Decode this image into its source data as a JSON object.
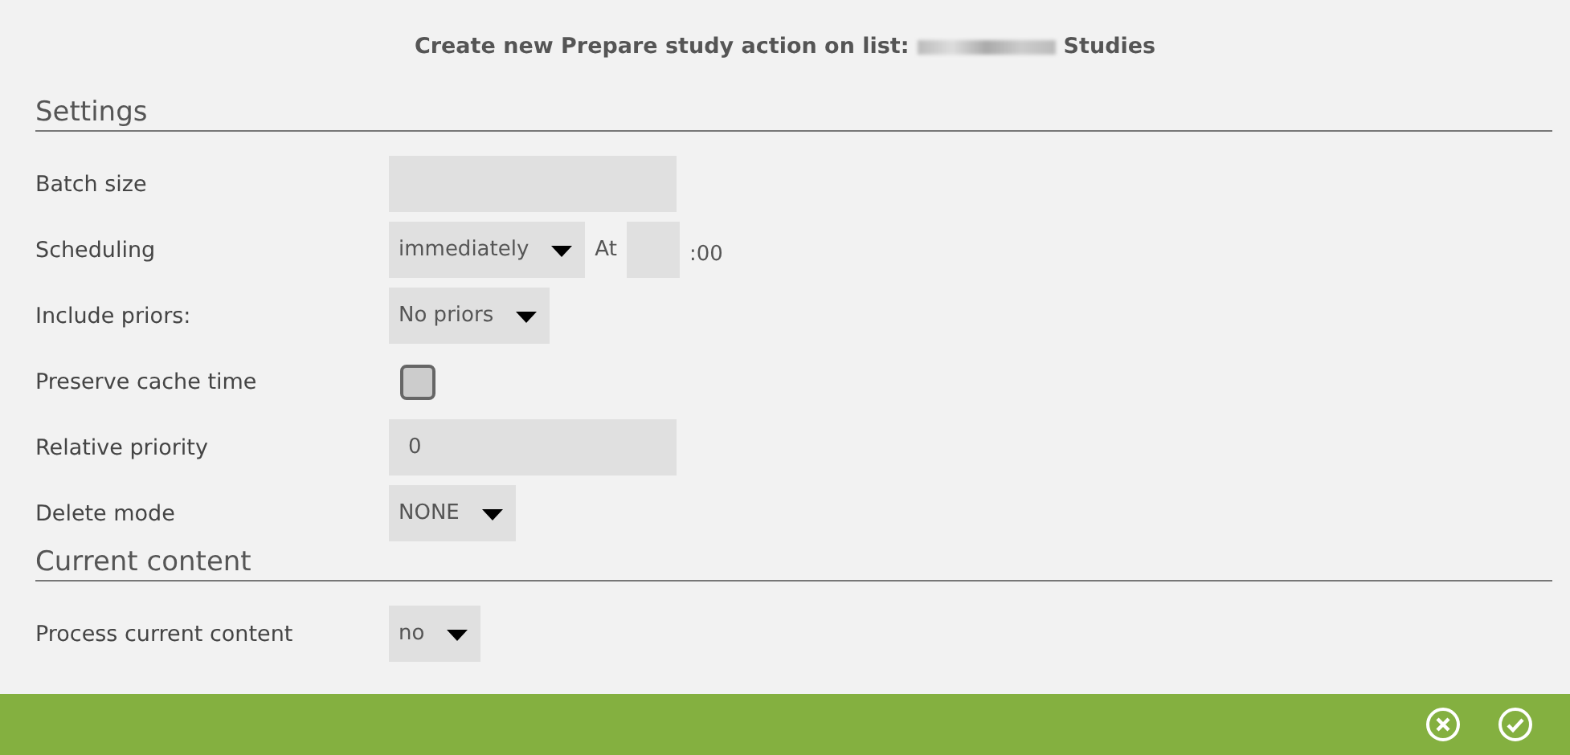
{
  "dialog": {
    "title_prefix": "Create new Prepare study action on list:",
    "title_suffix": "Studies"
  },
  "sections": [
    {
      "heading": "Settings",
      "rows": [
        {
          "label": "Batch size",
          "kind": "text",
          "value": ""
        },
        {
          "label": "Scheduling",
          "kind": "schedule",
          "value": "immediately",
          "at_label": "At",
          "hour": "",
          "minutes": ":00"
        },
        {
          "label": "Include priors:",
          "kind": "select",
          "value": "No priors"
        },
        {
          "label": "Preserve cache time",
          "kind": "checkbox",
          "checked": false
        },
        {
          "label": "Relative priority",
          "kind": "text",
          "value": "0"
        },
        {
          "label": "Delete mode",
          "kind": "select",
          "value": "NONE"
        }
      ]
    },
    {
      "heading": "Current content",
      "rows": [
        {
          "label": "Process current content",
          "kind": "select",
          "value": "no"
        }
      ]
    }
  ]
}
